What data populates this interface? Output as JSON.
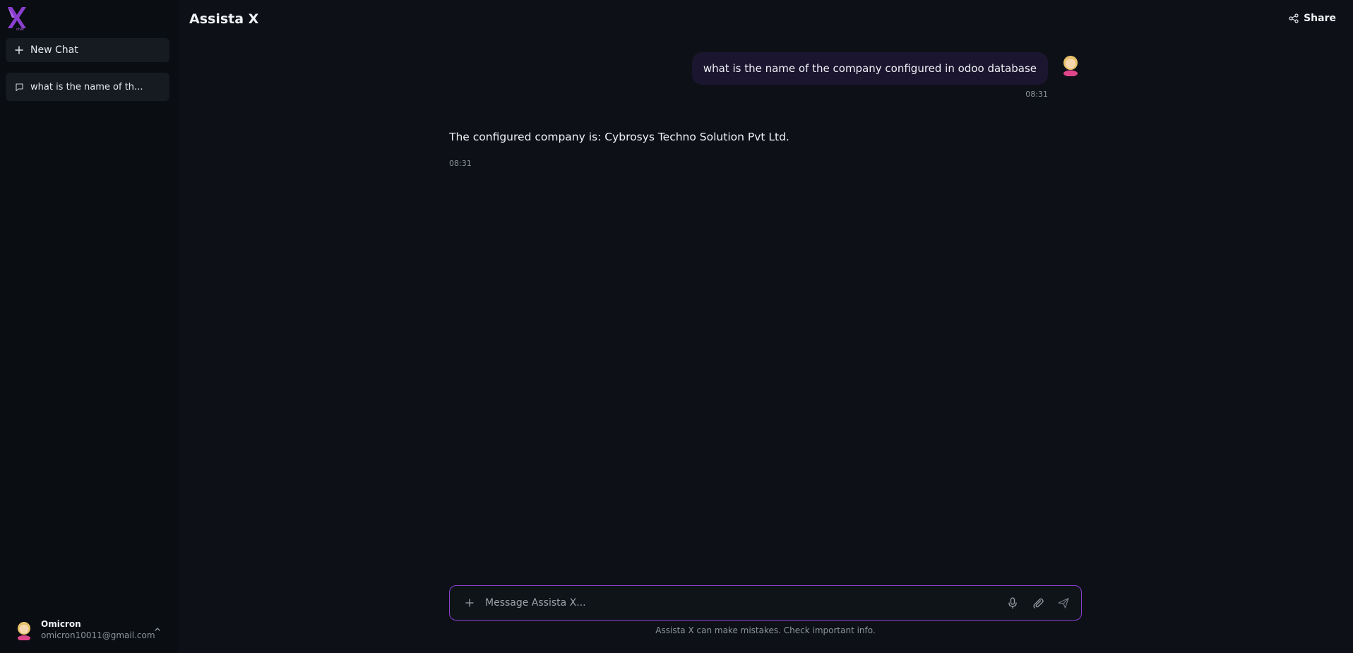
{
  "app": {
    "title": "Assista X"
  },
  "sidebar": {
    "logo_icon": "assista-x-logo",
    "new_chat_label": "New Chat",
    "history": [
      {
        "label": "what is the name of th..."
      }
    ],
    "user": {
      "name": "Omicron",
      "email": "omicron10011@gmail.com"
    }
  },
  "header": {
    "share_label": "Share"
  },
  "messages": [
    {
      "role": "user",
      "text": "what is the name of the company configured in odoo database",
      "time": "08:31"
    },
    {
      "role": "assistant",
      "text": "The configured company is: Cybrosys Techno Solution Pvt Ltd.",
      "time": "08:31"
    }
  ],
  "composer": {
    "placeholder": "Message Assista X..."
  },
  "footer": {
    "disclaimer": "Assista X can make mistakes. Check important info."
  },
  "colors": {
    "accent": "#8b3fd0",
    "background": "#0d1117",
    "sidebar": "#0a0d12",
    "user_bubble": "#1c1530"
  }
}
